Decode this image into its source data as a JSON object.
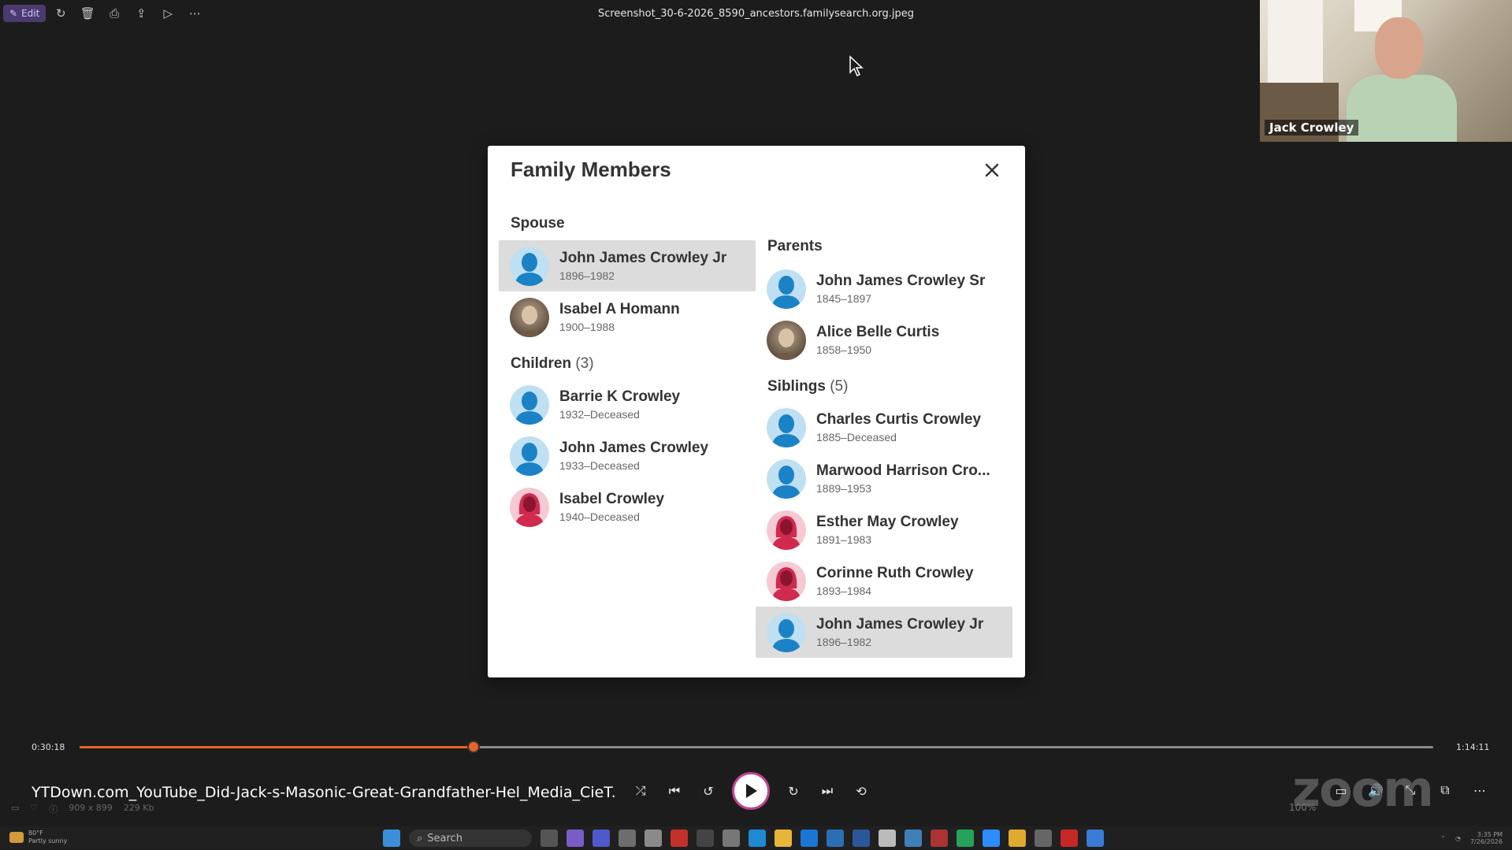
{
  "viewer": {
    "edit_label": "Edit",
    "toolbar_icons": [
      "rotate-icon",
      "delete-icon",
      "print-icon",
      "share-icon",
      "slideshow-icon",
      "more-icon"
    ],
    "file_title": "Screenshot_30-6-2026_8590_ancestors.familysearch.org.jpeg"
  },
  "video": {
    "participant_name": "Jack Crowley"
  },
  "modal": {
    "title": "Family Members",
    "spouse": {
      "heading": "Spouse",
      "people": [
        {
          "name": "John James Crowley Jr",
          "dates": "1896–1982",
          "gender": "male",
          "selected": true
        },
        {
          "name": "Isabel A Homann",
          "dates": "1900–1988",
          "gender": "photo",
          "selected": false
        }
      ]
    },
    "children": {
      "heading": "Children",
      "count": "(3)",
      "people": [
        {
          "name": "Barrie K Crowley",
          "dates": "1932–Deceased",
          "gender": "male"
        },
        {
          "name": "John James Crowley",
          "dates": "1933–Deceased",
          "gender": "male"
        },
        {
          "name": "Isabel Crowley",
          "dates": "1940–Deceased",
          "gender": "female"
        }
      ]
    },
    "parents": {
      "heading": "Parents",
      "people": [
        {
          "name": "John James Crowley Sr",
          "dates": "1845–1897",
          "gender": "male"
        },
        {
          "name": "Alice Belle Curtis",
          "dates": "1858–1950",
          "gender": "photo"
        }
      ]
    },
    "siblings": {
      "heading": "Siblings",
      "count": "(5)",
      "people": [
        {
          "name": "Charles Curtis Crowley",
          "dates": "1885–Deceased",
          "gender": "male"
        },
        {
          "name": "Marwood Harrison Cro...",
          "dates": "1889–1953",
          "gender": "male"
        },
        {
          "name": "Esther May Crowley",
          "dates": "1891–1983",
          "gender": "female"
        },
        {
          "name": "Corinne Ruth Crowley",
          "dates": "1893–1984",
          "gender": "female"
        },
        {
          "name": "John James Crowley Jr",
          "dates": "1896–1982",
          "gender": "male",
          "selected": true
        }
      ]
    }
  },
  "player": {
    "elapsed": "0:30:18",
    "total": "1:14:11",
    "progress_fraction": 0.291,
    "accent_color": "#e8622a",
    "media_title": "YTDown.com_YouTube_Did-Jack-s-Masonic-Great-Grandfather-Hel_Media_CieT...",
    "watermark": "zoom"
  },
  "footer": {
    "dimensions": "909 x 899",
    "file_size": "229 Kb",
    "zoom_percent": "100%"
  },
  "taskbar": {
    "weather_temp": "80°F",
    "weather_desc": "Partly sunny",
    "search_placeholder": "Search",
    "time": "3:35 PM",
    "date": "7/26/2026"
  },
  "colors": {
    "male_avatar": "#1b82c6",
    "female_avatar": "#d02a4f"
  }
}
